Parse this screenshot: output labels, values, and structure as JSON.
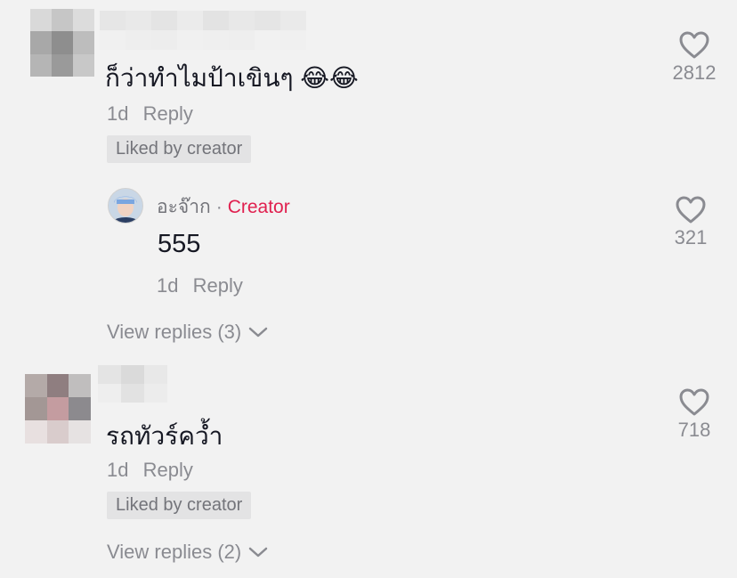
{
  "comments": [
    {
      "text": "ก็ว่าทำไมป้าเขินๆ 😂😂",
      "time": "1d",
      "reply_label": "Reply",
      "badge": "Liked by creator",
      "likes": "2812",
      "reply": {
        "author": "อะจ๊าก",
        "dot": "·",
        "author_tag": "Creator",
        "text": "555",
        "time": "1d",
        "reply_label": "Reply",
        "likes": "321"
      },
      "view_replies": "View replies (3)"
    },
    {
      "text": "รถทัวร์คว้ำ",
      "time": "1d",
      "reply_label": "Reply",
      "badge": "Liked by creator",
      "likes": "718",
      "view_replies": "View replies (2)"
    }
  ],
  "colors": {
    "background": "#f2f2f2",
    "text": "#161823",
    "muted": "#8a8b91",
    "creator_tag": "#e0204f",
    "badge_bg": "#e3e3e4"
  },
  "icons": [
    "heart-outline-icon",
    "chevron-down-icon"
  ]
}
